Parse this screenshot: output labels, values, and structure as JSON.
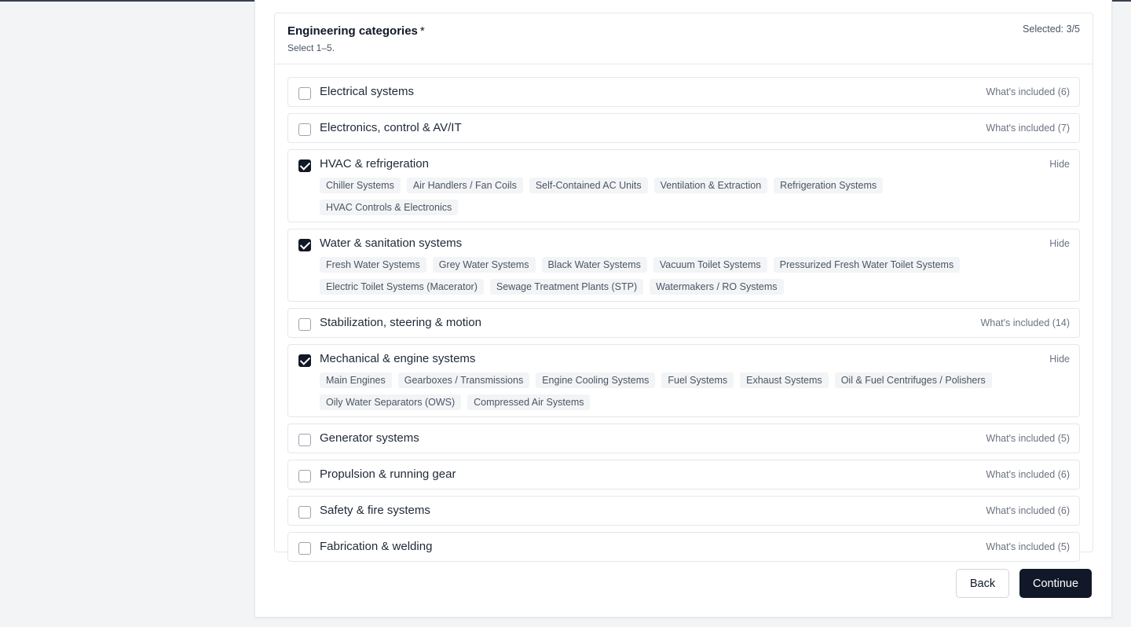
{
  "section": {
    "title": "Engineering categories",
    "required_mark": "*",
    "subtitle": "Select 1–5.",
    "selected_count": "Selected: 3/5"
  },
  "categories": [
    {
      "name": "Electrical systems",
      "checked": false,
      "toggle_label": "What's included (6)",
      "items": []
    },
    {
      "name": "Electronics, control & AV/IT",
      "checked": false,
      "toggle_label": "What's included (7)",
      "items": []
    },
    {
      "name": "HVAC & refrigeration",
      "checked": true,
      "toggle_label": "Hide",
      "items": [
        "Chiller Systems",
        "Air Handlers / Fan Coils",
        "Self-Contained AC Units",
        "Ventilation & Extraction",
        "Refrigeration Systems",
        "HVAC Controls & Electronics"
      ]
    },
    {
      "name": "Water & sanitation systems",
      "checked": true,
      "toggle_label": "Hide",
      "items": [
        "Fresh Water Systems",
        "Grey Water Systems",
        "Black Water Systems",
        "Vacuum Toilet Systems",
        "Pressurized Fresh Water Toilet Systems",
        "Electric Toilet Systems (Macerator)",
        "Sewage Treatment Plants (STP)",
        "Watermakers / RO Systems"
      ]
    },
    {
      "name": "Stabilization, steering & motion",
      "checked": false,
      "toggle_label": "What's included (14)",
      "items": []
    },
    {
      "name": "Mechanical & engine systems",
      "checked": true,
      "toggle_label": "Hide",
      "items": [
        "Main Engines",
        "Gearboxes / Transmissions",
        "Engine Cooling Systems",
        "Fuel Systems",
        "Exhaust Systems",
        "Oil & Fuel Centrifuges / Polishers",
        "Oily Water Separators (OWS)",
        "Compressed Air Systems"
      ]
    },
    {
      "name": "Generator systems",
      "checked": false,
      "toggle_label": "What's included (5)",
      "items": []
    },
    {
      "name": "Propulsion & running gear",
      "checked": false,
      "toggle_label": "What's included (6)",
      "items": []
    },
    {
      "name": "Safety & fire systems",
      "checked": false,
      "toggle_label": "What's included (6)",
      "items": []
    },
    {
      "name": "Fabrication & welding",
      "checked": false,
      "toggle_label": "What's included (5)",
      "items": []
    }
  ],
  "actions": {
    "back_label": "Back",
    "continue_label": "Continue"
  }
}
